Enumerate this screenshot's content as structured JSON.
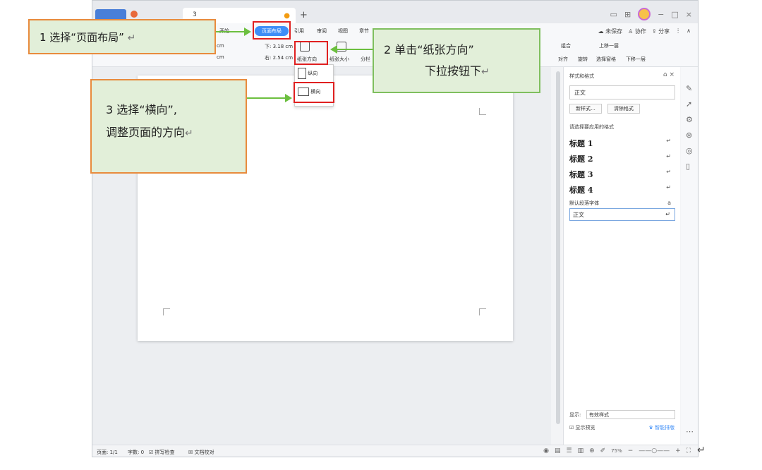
{
  "tabbar": {
    "doc_tab": "3"
  },
  "menu": {
    "start_partial": "开始",
    "page_layout": "页面布局",
    "reference_partial": "引用",
    "review": "审阅",
    "view": "视图",
    "chapter_partial": "章节",
    "unsaved": "未保存",
    "collab": "协作",
    "share": "分享"
  },
  "ribbon": {
    "margin_left_value": "cm",
    "margin_bottom_label": "下:",
    "margin_bottom_value": "3.18 cm",
    "margin_right_label": "右:",
    "margin_right_value": "2.54 cm",
    "paper_orientation": "纸张方向",
    "paper_size": "纸张大小",
    "columns": "分栏",
    "group": "组合",
    "move_up": "上移一层",
    "move_down": "下移一层",
    "align": "对齐",
    "rotate": "旋转",
    "selection_pane": "选择窗格"
  },
  "dropdown": {
    "portrait": "纵向",
    "landscape": "横向"
  },
  "style_pane": {
    "title": "样式和格式",
    "current_style": "正文",
    "new_style": "新样式...",
    "clear_format": "清除格式",
    "choose_label": "请选择要应用的格式",
    "styles": [
      "标题 1",
      "标题 2",
      "标题 3",
      "标题 4"
    ],
    "default_font": "默认段落字体",
    "body": "正文",
    "show_label": "显示:",
    "show_value": "有效样式",
    "preview": "显示预览",
    "smart_layout": "智能排版"
  },
  "statusbar": {
    "page": "页面: 1/1",
    "words": "字数: 0",
    "spell": "拼写检查",
    "proof": "文档校对",
    "zoom": "75%"
  },
  "callouts": {
    "step1": "1 选择“页面布局”",
    "step2_line1": "2 单击“纸张方向”",
    "step2_line2": "下拉按钮下",
    "step3_line1": "3 选择“横向”,",
    "step3_line2": "调整页面的方向"
  },
  "colors": {
    "accent": "#3e8ef7",
    "callout_bg": "#e2efd9",
    "callout_orange": "#e88b3d",
    "callout_green": "#7fbf5e",
    "highlight_red": "#e02020"
  }
}
